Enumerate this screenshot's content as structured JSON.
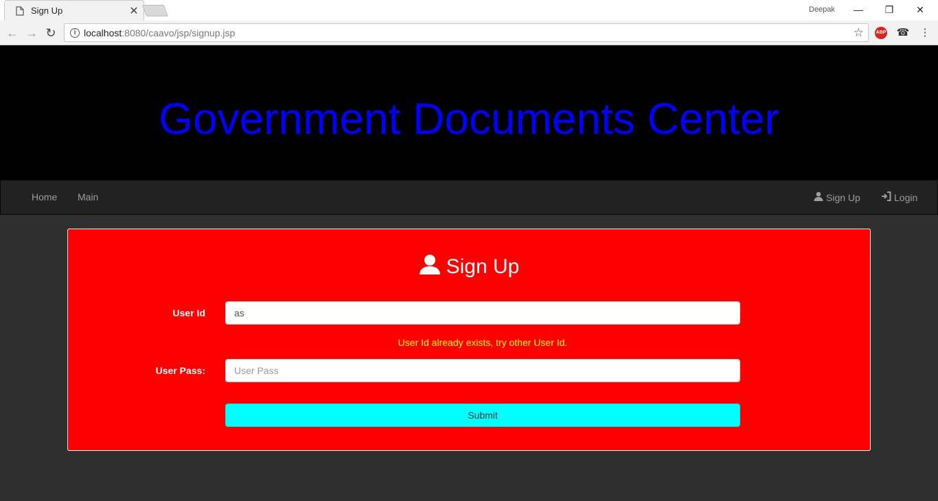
{
  "browser": {
    "tab_title": "Sign Up",
    "tab_close": "✕",
    "profile_name": "Deepak",
    "url_host": "localhost",
    "url_path": ":8080/caavo/jsp/signup.jsp",
    "abp_label": "ABP"
  },
  "site": {
    "title": "Government Documents Center"
  },
  "nav": {
    "left": [
      "Home",
      "Main"
    ],
    "signup": "Sign Up",
    "login": "Login"
  },
  "form": {
    "heading": "Sign Up",
    "userid_label": "User Id",
    "userid_value": "as",
    "error": "User Id already exists, try other User Id.",
    "userpass_label": "User Pass:",
    "userpass_placeholder": "User Pass",
    "submit_label": "Submit"
  },
  "colors": {
    "title": "#0000ff",
    "panel": "#ff0000",
    "submit": "#00ffff",
    "error": "#ffff00"
  }
}
